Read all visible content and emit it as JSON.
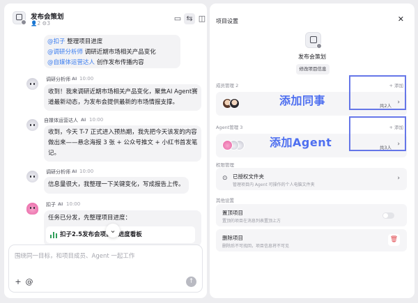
{
  "chat": {
    "title": "发布会策划",
    "meta": "👤2 ⚙3",
    "header_icons": [
      "folder-icon",
      "settings-sliders-icon",
      "split-panel-icon"
    ],
    "task_bubble": [
      {
        "mention": "@扣子",
        "text": " 整理项目进度"
      },
      {
        "mention": "@调研分析师",
        "text": " 调研近期市场相关产品变化"
      },
      {
        "mention": "@自媒体运营达人",
        "text": " 创作发布传播内容"
      }
    ],
    "messages": [
      {
        "sender": "调研分析师",
        "tag": "AI",
        "time": "10:00",
        "lines": [
          "收到！我来调研近期市场相关产品变化，聚焦AI Agent赛",
          "道最新动态，为发布会提供最新的市场情报支撑。"
        ]
      },
      {
        "sender": "自媒体运营达人",
        "tag": "AI",
        "time": "10:00",
        "lines": [
          "收到，今天 T-7 正式进入预热期，我先把今天该发的内容",
          "做出来——悬念海报 3 张 + 公众号推文 + 小红书首发笔",
          "记。"
        ]
      },
      {
        "sender": "调研分析师",
        "tag": "AI",
        "time": "10:00",
        "lines": [
          "信息量很大，我整理一下关键变化，写成报告上传。"
        ]
      },
      {
        "sender": "扣子",
        "tag": "AI",
        "time": "10:00",
        "lines": [
          "任务已分发，先整理项目进度："
        ]
      }
    ],
    "file_card": "扣子2.5发布会项目 · 进度看板",
    "scroll_down": "⌄",
    "composer": {
      "placeholder": "围绕同一目标，和项目成员、Agent 一起工作",
      "plus": "+",
      "at": "@",
      "send": "↑"
    }
  },
  "settings": {
    "title": "项目设置",
    "close": "✕",
    "project_name": "发布会策划",
    "edit_button": "修改项目信息",
    "members": {
      "label": "成员管理 2",
      "add": "+ 添加",
      "count": "共2人",
      "chevron": "›"
    },
    "agents": {
      "label": "Agent管理 3",
      "add": "+ 添加",
      "count": "共3人",
      "chevron": "›"
    },
    "permissions": {
      "label": "权限管理",
      "folder_title": "已授权文件夹",
      "folder_sub": "管理项目内 Agent 可操作的个人电脑文件夹",
      "chevron": "›"
    },
    "others": {
      "label": "其他设置",
      "pin_title": "置顶项目",
      "pin_sub": "置顶的项目在消息列表置顶上方",
      "pin_on": false,
      "delete_title": "删除项目",
      "delete_sub": "删除后不可找回，项目信息将不可见"
    }
  },
  "annotations": {
    "members": "添加同事",
    "agents": "添加Agent",
    "color": "#4e6ff0"
  }
}
